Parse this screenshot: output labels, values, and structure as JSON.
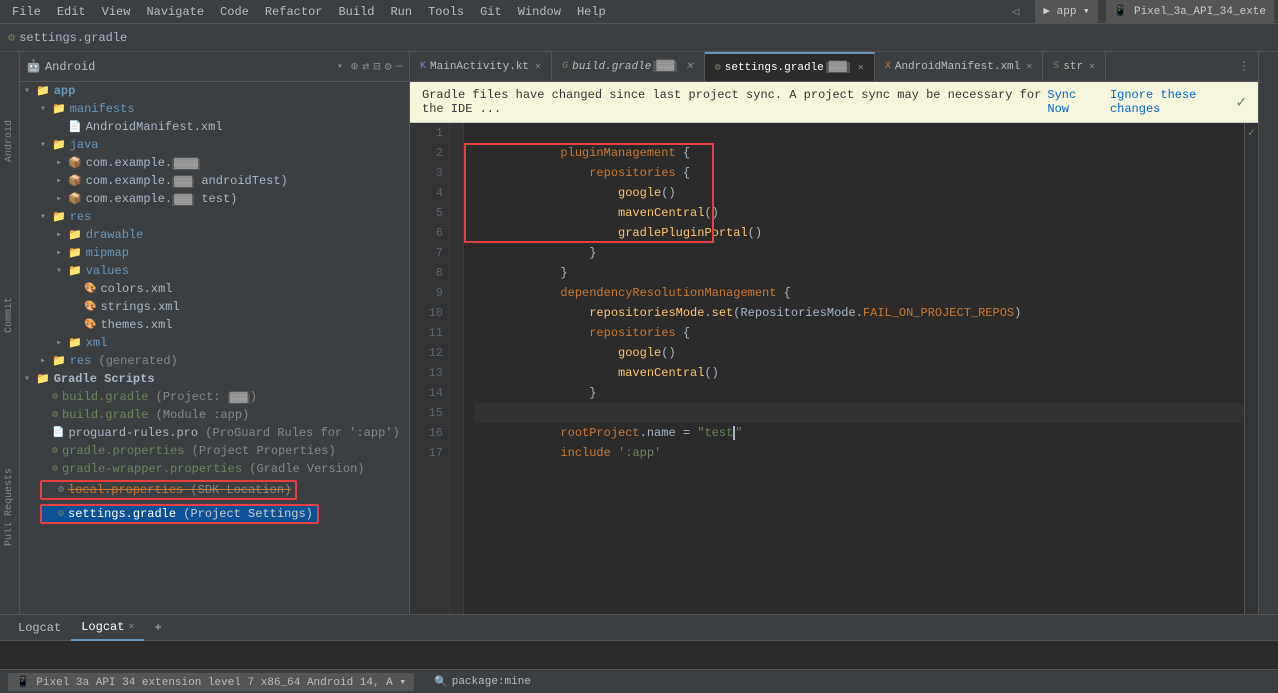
{
  "menuBar": {
    "items": [
      "File",
      "Edit",
      "View",
      "Navigate",
      "Code",
      "Refactor",
      "Build",
      "Run",
      "Tools",
      "Git",
      "Window",
      "Help"
    ]
  },
  "titleBar": {
    "fileName": "settings.gradle"
  },
  "tabs": [
    {
      "id": "main-activity",
      "label": "MainActivity.kt",
      "icon": "kt",
      "active": false,
      "modified": false
    },
    {
      "id": "build-gradle",
      "label": "build.gradle",
      "icon": "gradle",
      "active": false,
      "modified": true
    },
    {
      "id": "settings-gradle",
      "label": "settings.gradle",
      "icon": "gradle",
      "active": true,
      "modified": true
    },
    {
      "id": "android-manifest",
      "label": "AndroidManifest.xml",
      "icon": "xml",
      "active": false,
      "modified": false
    },
    {
      "id": "str",
      "label": "str",
      "icon": "xml",
      "active": false,
      "modified": false
    }
  ],
  "notification": {
    "message": "Gradle files have changed since last project sync. A project sync may be necessary for the IDE ...",
    "syncNow": "Sync Now",
    "ignore": "Ignore these changes"
  },
  "sidebar": {
    "title": "Android",
    "tree": [
      {
        "level": 0,
        "type": "folder",
        "label": "app",
        "expanded": true
      },
      {
        "level": 1,
        "type": "folder",
        "label": "manifests",
        "expanded": true
      },
      {
        "level": 2,
        "type": "file",
        "label": "AndroidManifest.xml",
        "icon": "xml"
      },
      {
        "level": 1,
        "type": "folder",
        "label": "java",
        "expanded": true
      },
      {
        "level": 2,
        "type": "package",
        "label": "com.example.",
        "suffix": "",
        "expanded": false
      },
      {
        "level": 2,
        "type": "package",
        "label": "com.example.",
        "suffix": "androidTest)",
        "expanded": false
      },
      {
        "level": 2,
        "type": "package",
        "label": "com.example.",
        "suffix": "test)",
        "expanded": false
      },
      {
        "level": 1,
        "type": "folder",
        "label": "res",
        "expanded": true
      },
      {
        "level": 2,
        "type": "folder",
        "label": "drawable",
        "expanded": false
      },
      {
        "level": 2,
        "type": "folder",
        "label": "mipmap",
        "expanded": false
      },
      {
        "level": 2,
        "type": "folder",
        "label": "values",
        "expanded": true
      },
      {
        "level": 3,
        "type": "file",
        "label": "colors.xml",
        "icon": "xml"
      },
      {
        "level": 3,
        "type": "file",
        "label": "strings.xml",
        "icon": "xml"
      },
      {
        "level": 3,
        "type": "file",
        "label": "themes.xml",
        "icon": "xml"
      },
      {
        "level": 2,
        "type": "folder",
        "label": "xml",
        "expanded": false
      },
      {
        "level": 1,
        "type": "folder",
        "label": "res (generated)",
        "expanded": false
      },
      {
        "level": 0,
        "type": "folder-gradle",
        "label": "Gradle Scripts",
        "expanded": true
      },
      {
        "level": 1,
        "type": "gradle",
        "label": "build.gradle (Project:",
        "suffix": ")"
      },
      {
        "level": 1,
        "type": "gradle",
        "label": "build.gradle (Module :app)"
      },
      {
        "level": 1,
        "type": "file-pro",
        "label": "proguard-rules.pro (ProGuard Rules for ':app')"
      },
      {
        "level": 1,
        "type": "gradle",
        "label": "gradle.properties (Project Properties)"
      },
      {
        "level": 1,
        "type": "gradle",
        "label": "gradle-wrapper.properties (Gradle Version)"
      },
      {
        "level": 1,
        "type": "file-strike",
        "label": "local.properties (SDK Location)"
      },
      {
        "level": 1,
        "type": "gradle-selected",
        "label": "settings.gradle (Project Settings)"
      }
    ]
  },
  "codeLines": [
    {
      "num": 1,
      "code": "pluginManagement {",
      "highlight": false
    },
    {
      "num": 2,
      "code": "    repositories {",
      "highlight": true
    },
    {
      "num": 3,
      "code": "        google()",
      "highlight": true
    },
    {
      "num": 4,
      "code": "        mavenCentral()",
      "highlight": true
    },
    {
      "num": 5,
      "code": "        gradlePluginPortal()",
      "highlight": true
    },
    {
      "num": 6,
      "code": "    }",
      "highlight": true
    },
    {
      "num": 7,
      "code": "}",
      "highlight": false
    },
    {
      "num": 8,
      "code": "dependencyResolutionManagement {",
      "highlight": false
    },
    {
      "num": 9,
      "code": "    repositoriesMode.set(RepositoriesMode.FAIL_ON_PROJECT_REPOS)",
      "highlight": false
    },
    {
      "num": 10,
      "code": "    repositories {",
      "highlight": false
    },
    {
      "num": 11,
      "code": "        google()",
      "highlight": false
    },
    {
      "num": 12,
      "code": "        mavenCentral()",
      "highlight": false
    },
    {
      "num": 13,
      "code": "    }",
      "highlight": false
    },
    {
      "num": 14,
      "code": "}",
      "hasDot": true,
      "highlight": false
    },
    {
      "num": 15,
      "code": "rootProject.name = \"test\"",
      "highlight": false,
      "active": true
    },
    {
      "num": 16,
      "code": "include ':app'",
      "highlight": false
    },
    {
      "num": 17,
      "code": "",
      "highlight": false
    }
  ],
  "bottomBar": {
    "tabs": [
      {
        "label": "Logcat",
        "active": false
      },
      {
        "label": "Logcat",
        "active": true
      }
    ],
    "addTab": "+"
  },
  "statusBar": {
    "device": "Pixel 3a API 34 extension level 7 x86_64  Android 14, A",
    "filter": "package:mine"
  },
  "leftLabels": [
    "Commit",
    "Pull Requests"
  ],
  "rightLabels": [],
  "colors": {
    "accent": "#6897bb",
    "string": "#6a8759",
    "keyword": "#cc7832",
    "redBorder": "#e84040"
  }
}
